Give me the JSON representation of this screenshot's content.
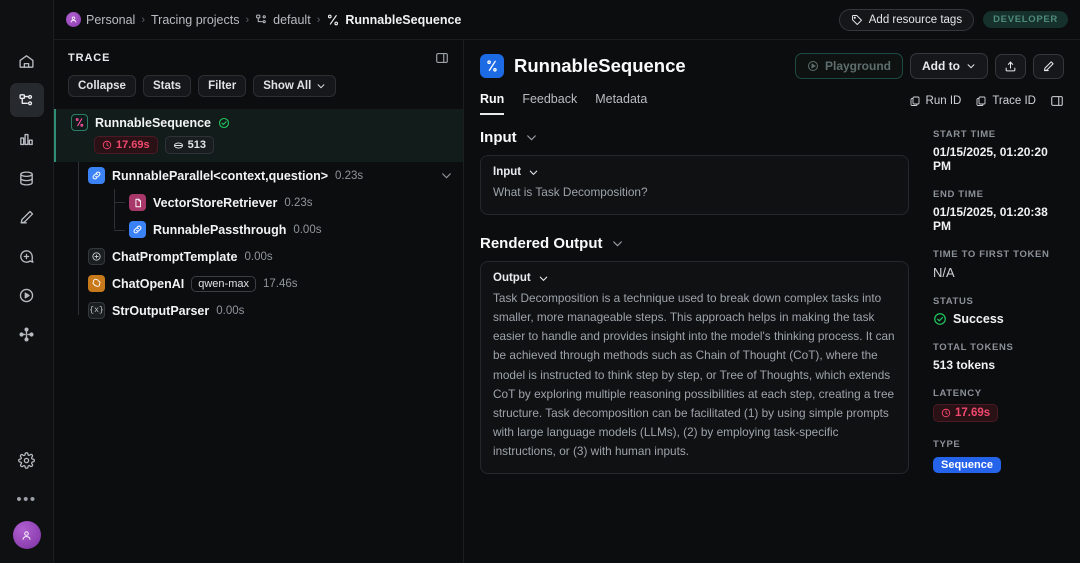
{
  "topbar": {
    "logo_name": "langsmith-logo",
    "panel_toggle": "panel-toggle-icon",
    "breadcrumbs": [
      {
        "label": "Personal",
        "icon": "user-avatar-icon"
      },
      {
        "label": "Tracing projects",
        "icon": ""
      },
      {
        "label": "default",
        "icon": "project-icon"
      },
      {
        "label": "RunnableSequence",
        "icon": "sequence-icon"
      }
    ],
    "add_tags_label": "Add resource tags",
    "plan_badge": "DEVELOPER"
  },
  "rail": {
    "items": [
      {
        "name": "home-icon",
        "active": false
      },
      {
        "name": "tracing-projects-icon",
        "active": true
      },
      {
        "name": "monitor-chart-icon",
        "active": false
      },
      {
        "name": "datasets-database-icon",
        "active": false
      },
      {
        "name": "annotation-pencil-icon",
        "active": false
      },
      {
        "name": "prompts-chat-icon",
        "active": false
      },
      {
        "name": "playground-play-icon",
        "active": false
      },
      {
        "name": "deployments-icon",
        "active": false
      }
    ],
    "settings_icon": "gear-icon",
    "more_icon": "ellipsis-icon",
    "avatar_icon": "user-avatar-icon"
  },
  "trace": {
    "title": "TRACE",
    "expand_icon": "panel-layout-icon",
    "tools": [
      {
        "label": "Collapse",
        "caret": false
      },
      {
        "label": "Stats",
        "caret": false
      },
      {
        "label": "Filter",
        "caret": false
      },
      {
        "label": "Show All",
        "caret": true
      }
    ],
    "root": {
      "name": "RunnableSequence",
      "status_icon": "check-circle-icon",
      "latency": "17.69s",
      "tokens": "513",
      "latency_icon": "clock-icon",
      "token_icon": "token-icon"
    },
    "nodes": [
      {
        "name": "RunnableParallel<context,question>",
        "duration": "0.23s",
        "icon": "chain-link-icon",
        "icon_color": "blue",
        "depth": 1,
        "chevron": true,
        "model": ""
      },
      {
        "name": "VectorStoreRetriever",
        "duration": "0.23s",
        "icon": "document-icon",
        "icon_color": "pink",
        "depth": 2,
        "chevron": false,
        "model": ""
      },
      {
        "name": "RunnablePassthrough",
        "duration": "0.00s",
        "icon": "chain-link-icon",
        "icon_color": "blue",
        "depth": 2,
        "chevron": false,
        "model": ""
      },
      {
        "name": "ChatPromptTemplate",
        "duration": "0.00s",
        "icon": "prompt-template-icon",
        "icon_color": "dark",
        "depth": 1,
        "chevron": false,
        "model": ""
      },
      {
        "name": "ChatOpenAI",
        "duration": "17.46s",
        "icon": "openai-icon",
        "icon_color": "orange",
        "depth": 1,
        "chevron": false,
        "model": "qwen-max"
      },
      {
        "name": "StrOutputParser",
        "duration": "0.00s",
        "icon": "string-parser-icon",
        "icon_color": "dark",
        "depth": 1,
        "chevron": false,
        "model": ""
      }
    ]
  },
  "detail": {
    "title": "RunnableSequence",
    "title_icon": "sequence-icon",
    "actions": {
      "playground": "Playground",
      "playground_icon": "play-circle-icon",
      "add_to": "Add to",
      "share_icon": "share-upload-icon",
      "edit_icon": "pencil-icon"
    },
    "tabs": [
      {
        "label": "Run",
        "active": true
      },
      {
        "label": "Feedback",
        "active": false
      },
      {
        "label": "Metadata",
        "active": false
      }
    ],
    "tabs_right": [
      {
        "label": "Run ID",
        "icon": "copy-icon"
      },
      {
        "label": "Trace ID",
        "icon": "copy-icon"
      }
    ],
    "panel_toggle_icon": "panel-layout-icon",
    "input_section": {
      "title": "Input",
      "card_label": "Input",
      "text": "What is Task Decomposition?"
    },
    "output_section": {
      "title": "Rendered Output",
      "card_label": "Output",
      "text": "Task Decomposition is a technique used to break down complex tasks into smaller, more manageable steps. This approach helps in making the task easier to handle and provides insight into the model's thinking process. It can be achieved through methods such as Chain of Thought (CoT), where the model is instructed to think step by step, or Tree of Thoughts, which extends CoT by exploring multiple reasoning possibilities at each step, creating a tree structure. Task decomposition can be facilitated (1) by using simple prompts with large language models (LLMs), (2) by employing task-specific instructions, or (3) with human inputs."
    }
  },
  "meta": {
    "start_time_label": "START TIME",
    "start_time": "01/15/2025, 01:20:20 PM",
    "end_time_label": "END TIME",
    "end_time": "01/15/2025, 01:20:38 PM",
    "ttft_label": "TIME TO FIRST TOKEN",
    "ttft": "N/A",
    "status_label": "STATUS",
    "status": "Success",
    "status_icon": "check-circle-icon",
    "tokens_label": "TOTAL TOKENS",
    "tokens": "513 tokens",
    "latency_label": "LATENCY",
    "latency": "17.69s",
    "latency_icon": "clock-icon",
    "type_label": "TYPE",
    "type": "Sequence"
  },
  "colors": {
    "accent_blue": "#2563eb",
    "success_green": "#22c55e",
    "latency_red": "#f2486e",
    "teal_border": "#2f8f77",
    "page_bg": "#0c0d0e"
  }
}
